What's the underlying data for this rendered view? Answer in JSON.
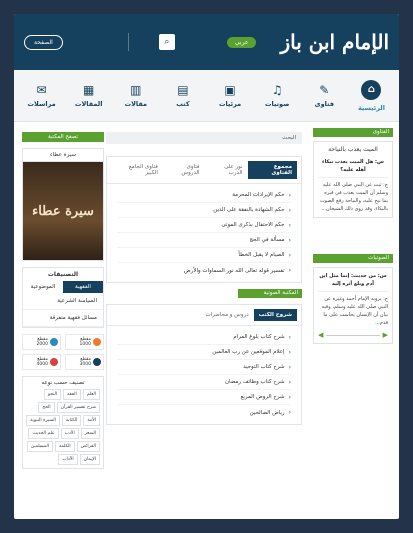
{
  "header": {
    "logo": "الإمام ابن باز",
    "lang": "عربي",
    "search_icon": "search-icon",
    "home_btn": "الصفحة"
  },
  "nav": [
    {
      "label": "الرئيسية",
      "icon": "home-icon",
      "glyph": "⌂",
      "active": true
    },
    {
      "label": "فتاوى",
      "icon": "pen-icon",
      "glyph": "✎"
    },
    {
      "label": "صوتيات",
      "icon": "headphones-icon",
      "glyph": "♫"
    },
    {
      "label": "مرئيات",
      "icon": "video-icon",
      "glyph": "▣"
    },
    {
      "label": "كتب",
      "icon": "book-icon",
      "glyph": "▤"
    },
    {
      "label": "مقالات",
      "icon": "article-icon",
      "glyph": "▥"
    },
    {
      "label": "المقالات",
      "icon": "page-icon",
      "glyph": "▦"
    },
    {
      "label": "مراسلات",
      "icon": "mail-icon",
      "glyph": "✉"
    }
  ],
  "breadcrumb": "البحث",
  "fatwa_card": {
    "bar": "الفتاوى",
    "title": "الميت يعذب بالنياحة",
    "question": "س: هل الميت يعذب ببكاء أهله عليه؟",
    "answer": "ج: ثبت عن النبي صلى الله عليه وسلم أن الميت يعذب في قبره بما نيح عليه، والنياحة رفع الصوت بالبكاء، وقد روى ذلك الشيخان..."
  },
  "audio_card": {
    "bar": "الصوتيات",
    "question": "س: من حديث: إنما مثل ابن آدم وبلغ أثره إليه",
    "answer": "ج: يرويه الإمام أحمد وغيره عن النبي صلى الله عليه وسلم، وفيه بيان أن الإنسان يحاسب على ما قدم..."
  },
  "tabs1": [
    "مجموع الفتاوى",
    "نور على الدرب",
    "فتاوى الدروس",
    "فتاوى الجامع الكبير"
  ],
  "list1": [
    "حكم الإيرادات المحرمة",
    "حكم الشهادة بالنفقة على الدين",
    "حكم الاحتفال بذكرى الموتى",
    "مسألة في الحج",
    "الصيام لا يقبل الخطأ",
    "تفسير قوله تعالى الله نور السماوات والأرض"
  ],
  "green_bar": "المكتبة الصوتية",
  "tabs2": [
    "شروح الكتب",
    "دروس و محاضرات"
  ],
  "list2": [
    "شرح كتاب بلوغ المرام",
    "إعلام الموقعين عن رب العالمين",
    "شرح كتاب التوحيد",
    "شرح كتاب وظائف رمضان",
    "شرح الروض المربع",
    "رياض الصالحين"
  ],
  "sidebar": {
    "show_btn": "تصفح المكتبة",
    "book_title": "سيرة عطاء",
    "book_art": "سيرة عطاء",
    "cats_title": "التصنيفات",
    "cats_tabs": [
      "الفقهية",
      "الموضوعية"
    ],
    "cats_items": [
      "السياسة الشرعية",
      "مسائل فقهية متفرقة"
    ],
    "stats": [
      {
        "label": "مقطع 1000",
        "color": "#f07b2a"
      },
      {
        "label": "مقطع 2000",
        "color": "#2a8ab8"
      },
      {
        "label": "مقطع 3000",
        "color": "#16415e"
      },
      {
        "label": "مقطع 4000",
        "color": "#d94040"
      }
    ],
    "tags_title": "تصنيف حسب نوعه",
    "tags": [
      "العلم",
      "الفقه",
      "النحو",
      "شرح تفسير القرآن",
      "الحج",
      "الأمة",
      "الكتابة",
      "السيرة النبوية",
      "الشعر",
      "الأدب",
      "علم الحديث",
      "الفرائض",
      "الكلمة",
      "المسلمين",
      "الإيمان",
      "الآداب"
    ]
  }
}
